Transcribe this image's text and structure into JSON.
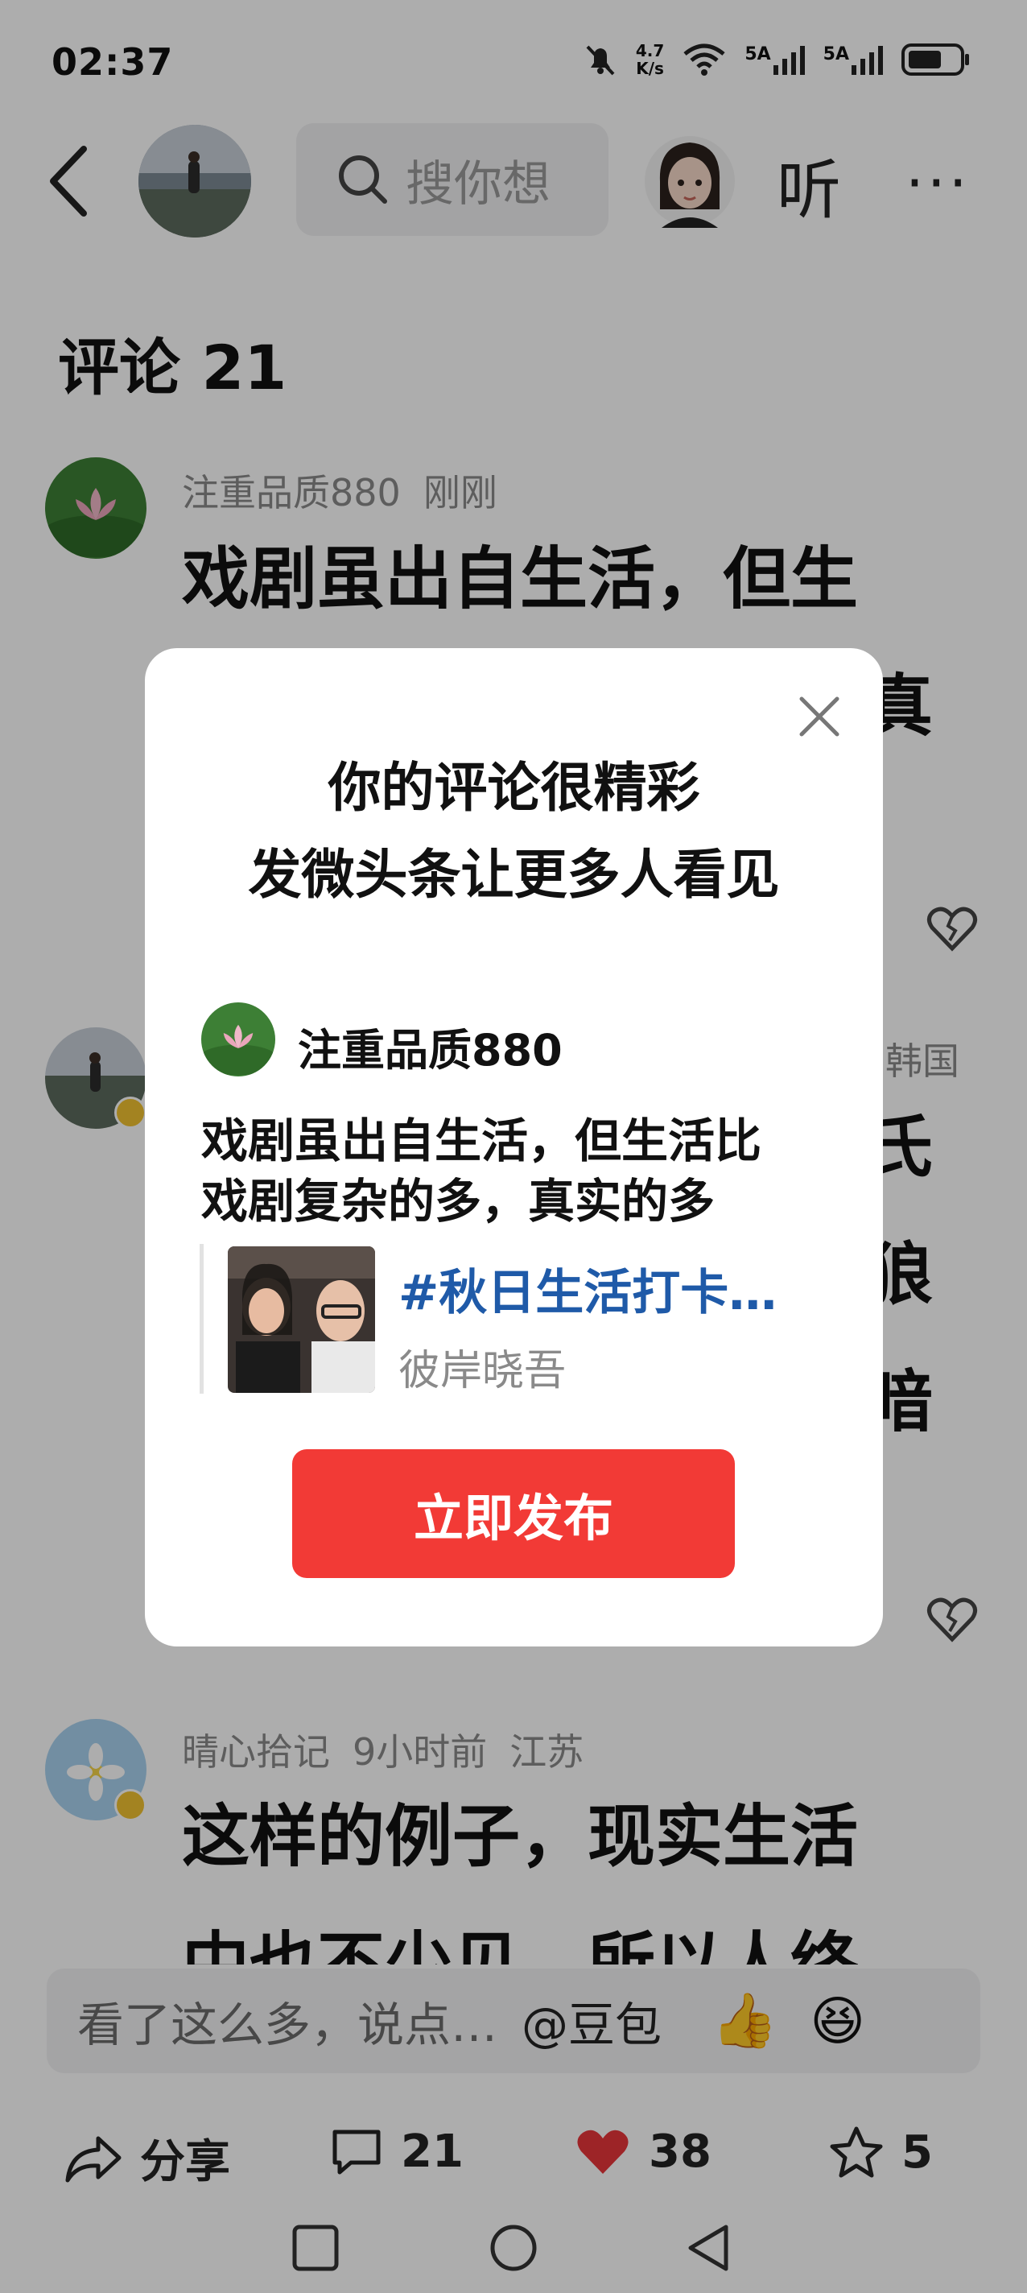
{
  "status_bar": {
    "time": "02:37",
    "net_speed_value": "4.7",
    "net_speed_unit": "K/s",
    "signal1": "5A",
    "signal2": "5A"
  },
  "top_bar": {
    "search_placeholder": "搜你想",
    "listen_label": "听",
    "more_label": "···"
  },
  "comments_header": "评论 21",
  "comments": [
    {
      "user": "注重品质880",
      "time": "刚刚",
      "location": "",
      "line1": "戏剧虽出自生活，但生",
      "line2": "真"
    },
    {
      "user": "",
      "time": "",
      "location": "韩国",
      "line1": "氏",
      "line2": "狼",
      "line3": "暗"
    },
    {
      "user": "晴心拾记",
      "time": "9小时前",
      "location": "江苏",
      "line1": "这样的例子，现实生活",
      "line2": "中也不少见，所以人终"
    }
  ],
  "modal": {
    "title_line1": "你的评论很精彩",
    "title_line2": "发微头条让更多人看见",
    "username": "注重品质880",
    "comment_line1": "戏剧虽出自生活，但生活比",
    "comment_line2": "戏剧复杂的多，真实的多",
    "quote_tag": "#秋日生活打卡…",
    "quote_author": "彼岸晓吾",
    "publish_label": "立即发布"
  },
  "input_bar": {
    "placeholder": "看了这么多，说点…",
    "mention": "@豆包"
  },
  "actions": {
    "share_label": "分享",
    "comment_count": "21",
    "like_count": "38",
    "favorite_count": "5"
  },
  "colors": {
    "publish_button": "#f23a36",
    "quote_tag": "#1f5aa8",
    "like_heart": "#e8353a"
  }
}
